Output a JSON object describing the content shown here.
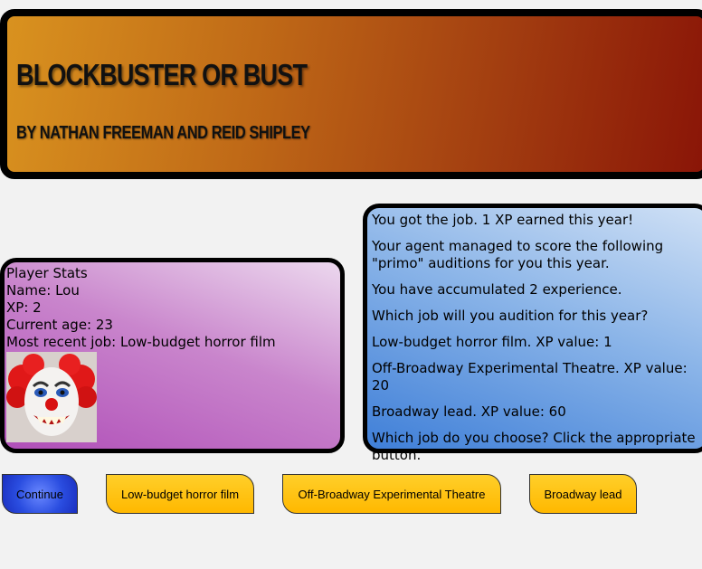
{
  "header": {
    "title": "BLOCKBUSTER OR BUST",
    "subtitle": "BY NATHAN FREEMAN AND REID SHIPLEY"
  },
  "stats": {
    "heading": "Player Stats",
    "name": "Name: Lou",
    "xp": "XP: 2",
    "age": "Current age: 23",
    "recent_job": "Most recent job: Low-budget horror film",
    "image_icon": "clown-portrait"
  },
  "story": {
    "result": "You got the job. 1 XP earned this year!",
    "agent": "Your agent managed to score the following \"primo\" auditions for you this year.",
    "accumulated": "You have accumulated 2 experience.",
    "question": "Which job will you audition for this year?",
    "job1": "Low-budget horror film. XP value: 1",
    "job2": "Off-Broadway Experimental Theatre. XP value: 20",
    "job3": "Broadway lead. XP value: 60",
    "prompt": "Which job do you choose? Click the appropriate button."
  },
  "buttons": {
    "continue": "Continue",
    "horror": "Low-budget horror film",
    "off_broadway": "Off-Broadway Experimental Theatre",
    "broadway": "Broadway lead"
  },
  "colors": {
    "continue_bg": "#2a4de0",
    "job_button_bg": "#ffb800",
    "stats_panel": "#c985cc",
    "story_panel": "#8ab4e8",
    "banner_left": "#d9921f",
    "banner_right": "#8a1507"
  }
}
